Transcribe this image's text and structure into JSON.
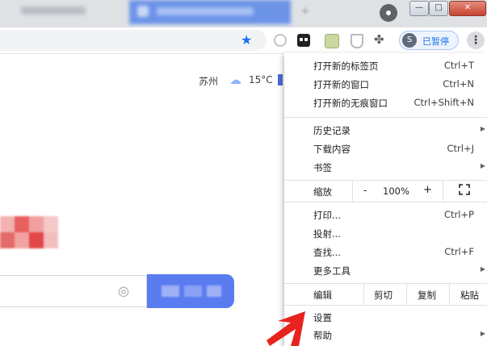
{
  "titlebar": {
    "tabs": [
      {
        "label": ""
      },
      {
        "label": ""
      }
    ],
    "new_tab_label": "+",
    "window_buttons": {
      "minimize": "—",
      "maximize": "□",
      "close": "✕"
    }
  },
  "toolbar": {
    "icons": [
      "star-icon",
      "extension-icon",
      "puzzle-icon",
      "kebab-menu-icon"
    ],
    "profile_initial": "S",
    "paused_label": "已暂停",
    "menu_glyph": "⋮"
  },
  "weather": {
    "city": "苏州",
    "temperature": "15°C"
  },
  "search": {
    "placeholder": ""
  },
  "menu": {
    "items1": [
      {
        "label": "打开新的标签页",
        "shortcut": "Ctrl+T"
      },
      {
        "label": "打开新的窗口",
        "shortcut": "Ctrl+N"
      },
      {
        "label": "打开新的无痕窗口",
        "shortcut": "Ctrl+Shift+N"
      }
    ],
    "items2": [
      {
        "label": "历史记录",
        "shortcut": ""
      },
      {
        "label": "下载内容",
        "shortcut": "Ctrl+J"
      },
      {
        "label": "书签",
        "shortcut": ""
      }
    ],
    "zoom": {
      "label": "缩放",
      "minus": "-",
      "value": "100%",
      "plus": "+"
    },
    "items3": [
      {
        "label": "打印...",
        "shortcut": "Ctrl+P"
      },
      {
        "label": "投射...",
        "shortcut": ""
      },
      {
        "label": "查找...",
        "shortcut": "Ctrl+F"
      },
      {
        "label": "更多工具",
        "shortcut": ""
      }
    ],
    "edit": {
      "label": "编辑",
      "cut": "剪切",
      "copy": "复制",
      "paste": "粘贴"
    },
    "items4": [
      {
        "label": "设置",
        "shortcut": ""
      },
      {
        "label": "帮助",
        "shortcut": ""
      }
    ],
    "submenu_arrow": "▶"
  },
  "colors": {
    "accent": "#1a73e8",
    "search_button": "#5b7cf1",
    "annotation_arrow": "#e8231e"
  }
}
